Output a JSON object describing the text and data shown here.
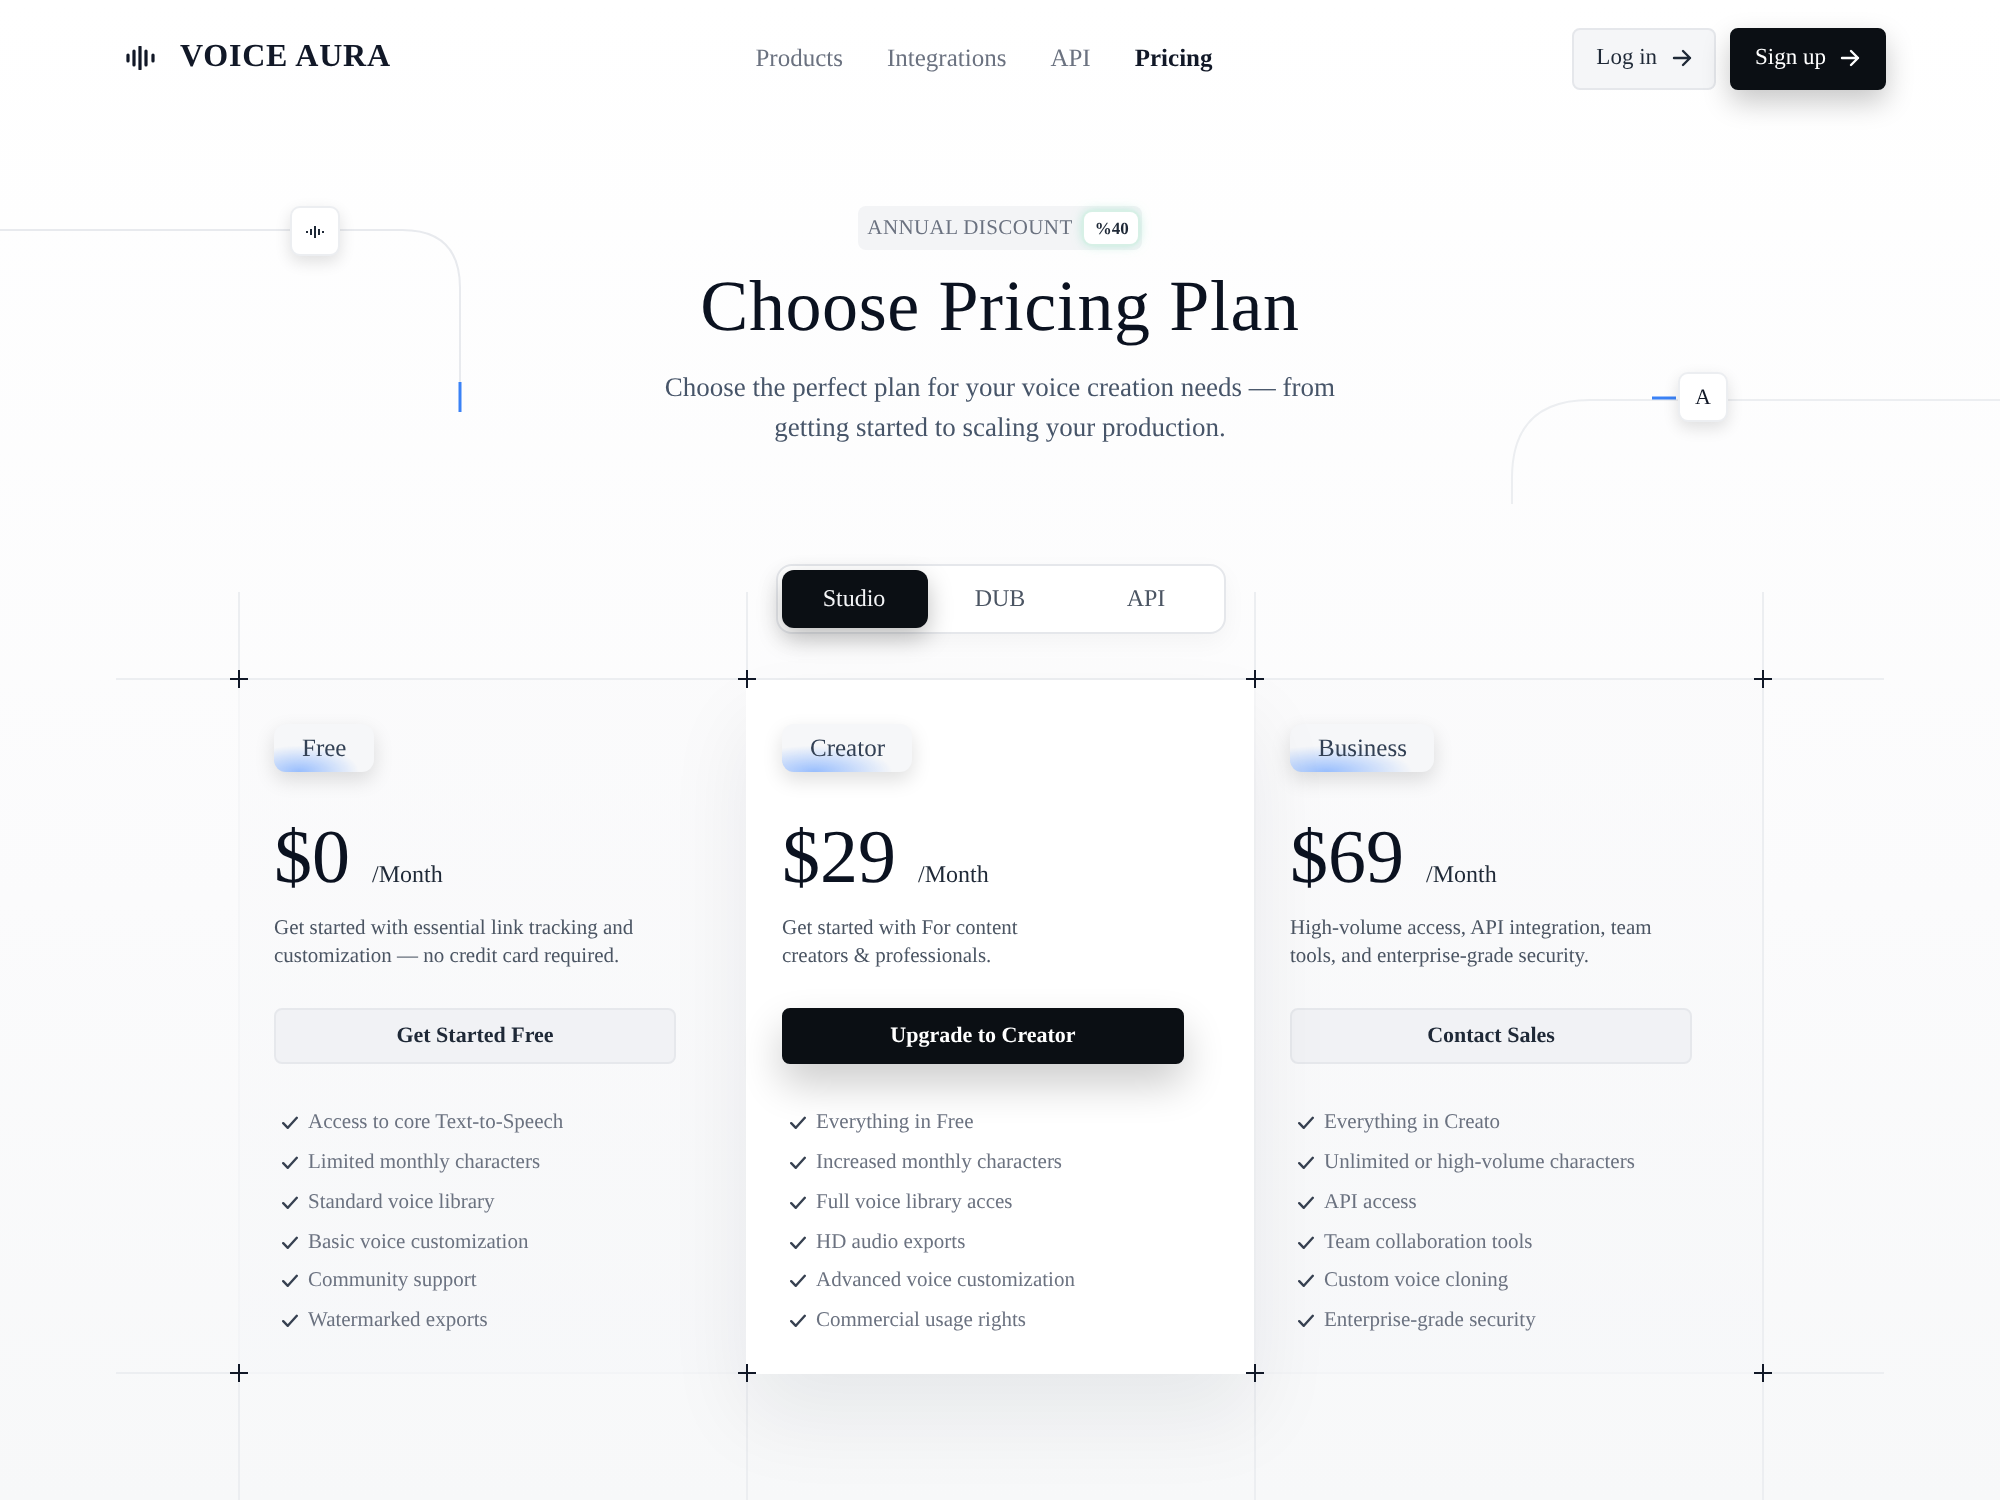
{
  "nav": {
    "brand": "VOICE AURA",
    "links": [
      {
        "label": "Products",
        "selected": false
      },
      {
        "label": "Integrations",
        "selected": false
      },
      {
        "label": "API",
        "selected": false
      },
      {
        "label": "Pricing",
        "selected": true
      }
    ],
    "login": "Log in",
    "signup": "Sign up"
  },
  "hero": {
    "badge_label": "ANNUAL DISCOUNT",
    "badge_value": "%40",
    "title": "Choose Pricing Plan",
    "subtitle": "Choose the perfect plan for your voice creation needs — from\ngetting started to scaling your production.",
    "letter_tile": "A"
  },
  "tabs": [
    {
      "label": "Studio",
      "selected": true
    },
    {
      "label": "DUB",
      "selected": false
    },
    {
      "label": "API",
      "selected": false
    }
  ],
  "plans": [
    {
      "name": "Free",
      "price": "$0",
      "period": "/Month",
      "description": "Get started with essential link tracking and\ncustomization — no credit card required.",
      "button": "Get Started Free",
      "featured": false,
      "features": [
        "Access to core Text-to-Speech",
        "Limited monthly characters",
        "Standard voice library",
        "Basic voice customization",
        "Community support",
        "Watermarked exports"
      ]
    },
    {
      "name": "Creator",
      "price": "$29",
      "period": "/Month",
      "description": "Get started with For content\ncreators & professionals.",
      "button": "Upgrade to Creator",
      "featured": true,
      "features": [
        "Everything in Free",
        "Increased monthly characters",
        "Full voice library acces",
        "HD audio exports",
        "Advanced voice customization",
        "Commercial usage rights"
      ]
    },
    {
      "name": "Business",
      "price": "$69",
      "period": "/Month",
      "description": "High-volume access, API integration, team\ntools, and enterprise-grade security.",
      "button": "Contact Sales",
      "featured": false,
      "features": [
        "Everything in Creato",
        "Unlimited or high-volume characters",
        "API access",
        "Team collaboration tools",
        "Custom voice cloning",
        "Enterprise-grade security"
      ]
    }
  ]
}
